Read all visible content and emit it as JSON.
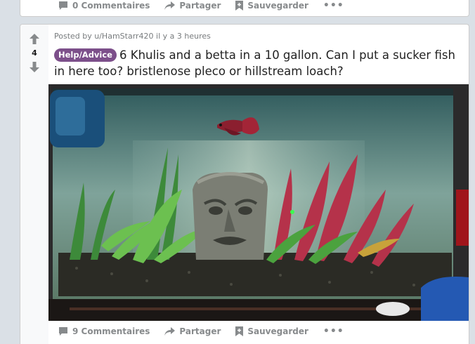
{
  "top_post": {
    "comments_label": "0 Commentaires",
    "share_label": "Partager",
    "save_label": "Sauvegarder",
    "more_label": "•••"
  },
  "post": {
    "vote_count": "4",
    "meta": "Posted by u/HamStarr420 il y a 3 heures",
    "flair": "Help/Advice",
    "title": "6 Khulis and a betta in a 10 gallon. Can I put a sucker fish in here too? bristlenose pleco or hillstream loach?",
    "image_alt": "Aquarium with a red betta fish, green plants and a stone face decoration",
    "comments_label": "9 Commentaires",
    "share_label": "Partager",
    "save_label": "Sauvegarder",
    "more_label": "•••"
  },
  "colors": {
    "background": "#dae0e6",
    "flair": "#7c4f8a",
    "action_text": "#878a8c"
  }
}
